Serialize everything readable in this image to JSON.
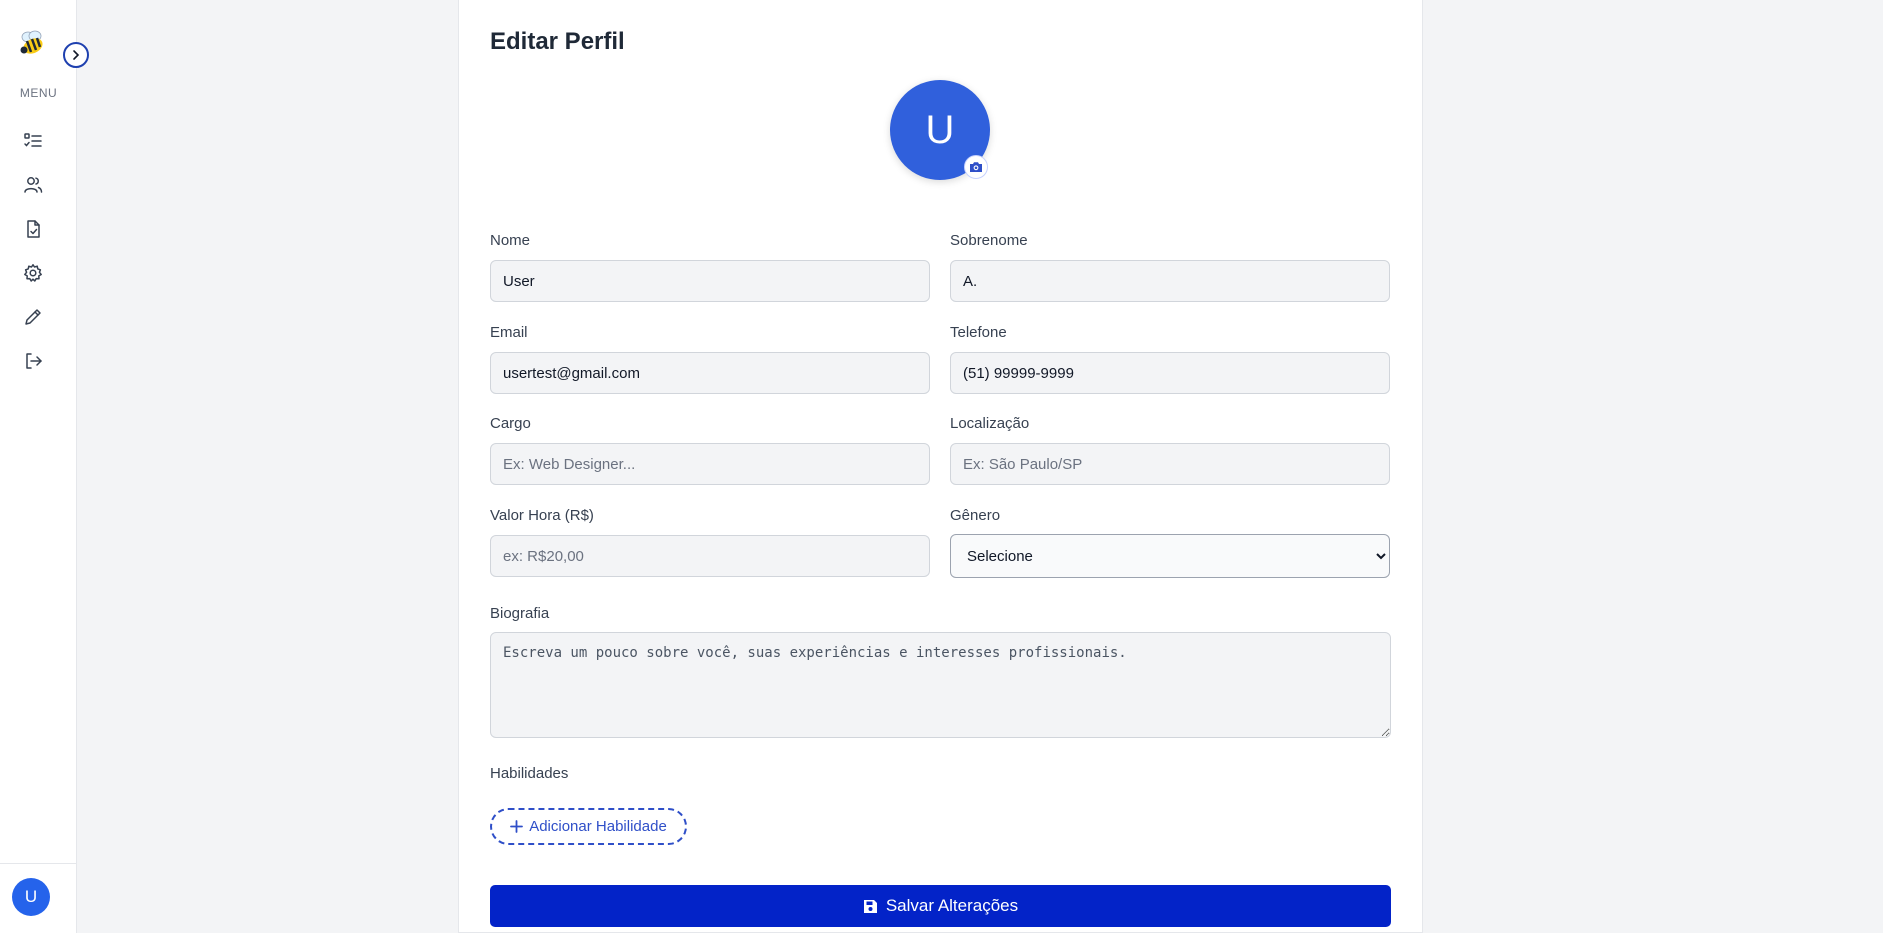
{
  "sidebar": {
    "menu_label": "MENU",
    "user_initial": "U",
    "items": [
      {
        "icon": "list-check-icon"
      },
      {
        "icon": "users-icon"
      },
      {
        "icon": "file-check-icon"
      },
      {
        "icon": "gear-icon"
      },
      {
        "icon": "pencil-icon"
      },
      {
        "icon": "logout-icon"
      }
    ]
  },
  "profile": {
    "title": "Editar Perfil",
    "avatar_initial": "U",
    "fields": {
      "nome": {
        "label": "Nome",
        "value": "User",
        "placeholder": ""
      },
      "sobrenome": {
        "label": "Sobrenome",
        "value": "A.",
        "placeholder": ""
      },
      "email": {
        "label": "Email",
        "value": "usertest@gmail.com",
        "placeholder": ""
      },
      "telefone": {
        "label": "Telefone",
        "value": "(51) 99999-9999",
        "placeholder": ""
      },
      "cargo": {
        "label": "Cargo",
        "value": "",
        "placeholder": "Ex: Web Designer..."
      },
      "localizacao": {
        "label": "Localização",
        "value": "",
        "placeholder": "Ex: São Paulo/SP"
      },
      "valor_hora": {
        "label": "Valor Hora (R$)",
        "value": "",
        "placeholder": "ex: R$20,00"
      },
      "genero": {
        "label": "Gênero",
        "selected": "Selecione"
      },
      "biografia": {
        "label": "Biografia",
        "placeholder": "Escreva um pouco sobre você, suas experiências e interesses profissionais."
      }
    },
    "skills_label": "Habilidades",
    "add_skill_label": "Adicionar Habilidade",
    "save_label": "Salvar Alterações"
  },
  "colors": {
    "accent": "#0323c8",
    "avatar_bg": "#3060dc",
    "link": "#2f4fc8"
  }
}
